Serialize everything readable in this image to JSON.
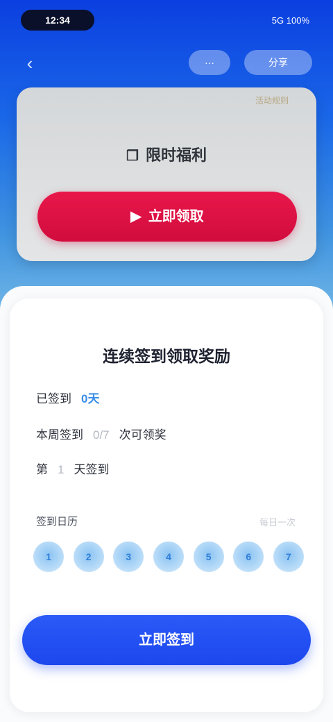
{
  "status_bar": {
    "time": "12:34",
    "indicators": "5G 100%"
  },
  "nav": {
    "back_icon": "back-arrow-icon",
    "pill_one": "···",
    "pill_two": "分享"
  },
  "hero": {
    "corner_text": "活动规则",
    "title_icon": "gift-icon",
    "title": "限时福利",
    "button_icon": "play-icon",
    "button_label": "立即领取",
    "button_color": "#d20c3e"
  },
  "card": {
    "title": "连续签到领取奖励",
    "row1_label": "已签到",
    "row1_value": "0天",
    "row2_label": "本周签到",
    "row2_value": "0/7",
    "row2_suffix": "次可领奖",
    "row3_label": "第",
    "row3_value": "1",
    "row3_suffix": "天签到",
    "dots_label": "签到日历",
    "dots_hint": "每日一次",
    "days": [
      "1",
      "2",
      "3",
      "4",
      "5",
      "6",
      "7"
    ],
    "accent_color": "#3a8ee8"
  },
  "cta": {
    "label": "立即签到",
    "color": "#1c47ee"
  }
}
